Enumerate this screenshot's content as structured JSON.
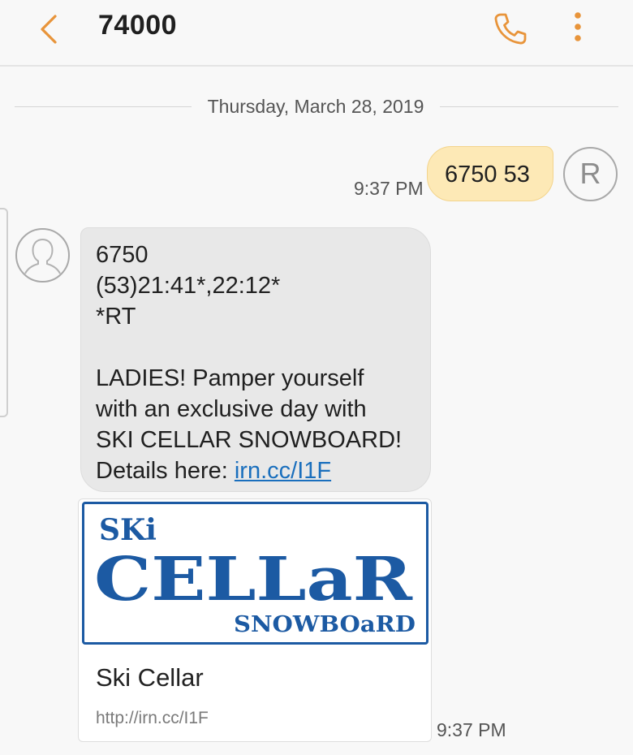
{
  "header": {
    "title": "74000",
    "back_icon": "chevron-left-icon",
    "call_icon": "phone-icon",
    "more_icon": "more-vertical-icon",
    "accent_color": "#e8943a"
  },
  "date_divider": "Thursday, March 28, 2019",
  "sent_message": {
    "text": "6750 53",
    "time": "9:37 PM",
    "avatar_letter": "R",
    "bubble_color": "#fde9b6"
  },
  "received_message": {
    "lines": [
      "6750",
      "(53)21:41*,22:12*",
      "*RT"
    ],
    "body_lines": [
      "LADIES! Pamper yourself",
      "with an exclusive day with",
      "SKI CELLAR SNOWBOARD!"
    ],
    "details_prefix": "Details here: ",
    "link_text": "irn.cc/I1F",
    "avatar_icon": "person-icon",
    "bubble_color": "#e8e8e8"
  },
  "link_preview": {
    "logo": {
      "ski": "SKi",
      "cellar": "CELLaR",
      "snowboard": "SNOWBOaRD",
      "color": "#1c5aa3"
    },
    "title": "Ski Cellar",
    "url": "http://irn.cc/I1F",
    "time": "9:37 PM"
  }
}
